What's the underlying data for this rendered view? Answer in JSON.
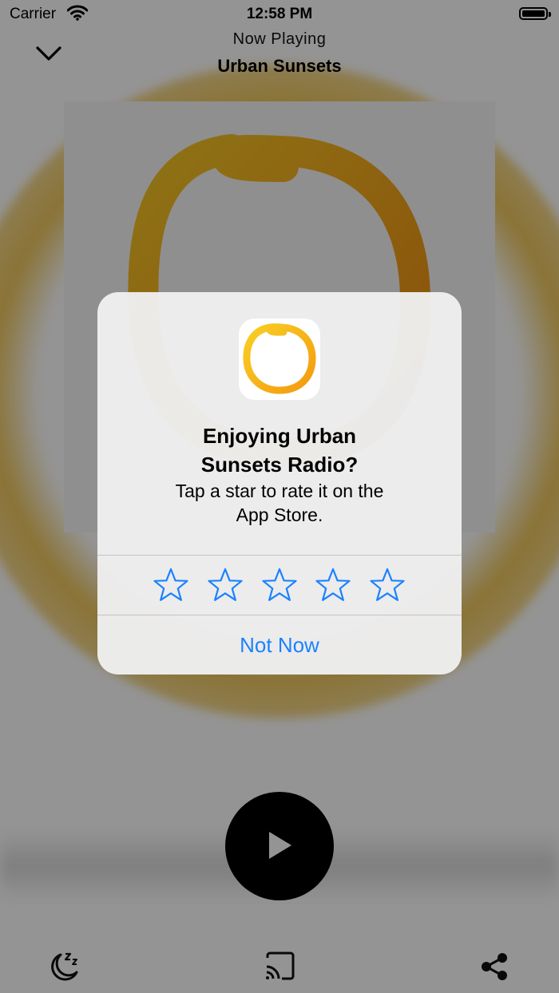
{
  "status_bar": {
    "carrier": "Carrier",
    "time": "12:58 PM"
  },
  "header": {
    "subtitle": "Now Playing",
    "title": "Urban Sunsets"
  },
  "alert": {
    "title_line1": "Enjoying Urban",
    "title_line2": "Sunsets Radio?",
    "message_line1": "Tap a star to rate it on the",
    "message_line2": "App Store.",
    "rating": 0,
    "rating_max": 5,
    "dismiss_label": "Not Now"
  },
  "toolbar": {
    "left_icon": "sleep-timer-icon",
    "center_icon": "cast-icon",
    "right_icon": "share-icon"
  },
  "colors": {
    "accent": "#1a82ff",
    "brand": "#f0b323",
    "overlay": "rgba(0,0,0,0.42)"
  }
}
